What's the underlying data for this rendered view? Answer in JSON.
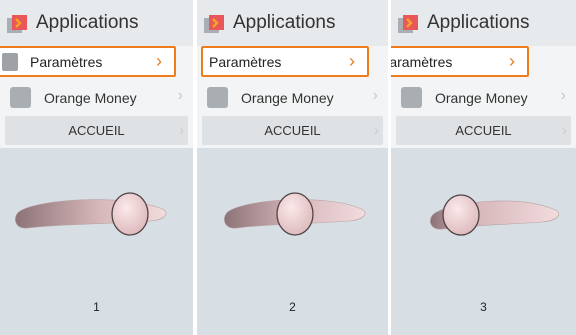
{
  "panels": [
    {
      "title": "Applications",
      "rows": {
        "settings": "Paramètres",
        "money": "Orange Money"
      },
      "home_button": "ACCUEIL",
      "step": "1",
      "slider_value": 0.6
    },
    {
      "title": "Applications",
      "rows": {
        "settings": "Paramètres",
        "money": "Orange Money"
      },
      "home_button": "ACCUEIL",
      "step": "2",
      "slider_value": 0.5
    },
    {
      "title": "Applications",
      "rows": {
        "settings": "Paramètres",
        "money": "Orange Money"
      },
      "home_button": "ACCUEIL",
      "step": "3",
      "slider_value": 0.3
    }
  ],
  "icons": {
    "app": "app-logo-icon",
    "chevron": "chevron-right-icon"
  },
  "colors": {
    "accent": "#f07c1c",
    "header_bg": "#e6eaed",
    "screen_bg": "#d7dfe5",
    "list_bg": "#f2f4f5"
  }
}
